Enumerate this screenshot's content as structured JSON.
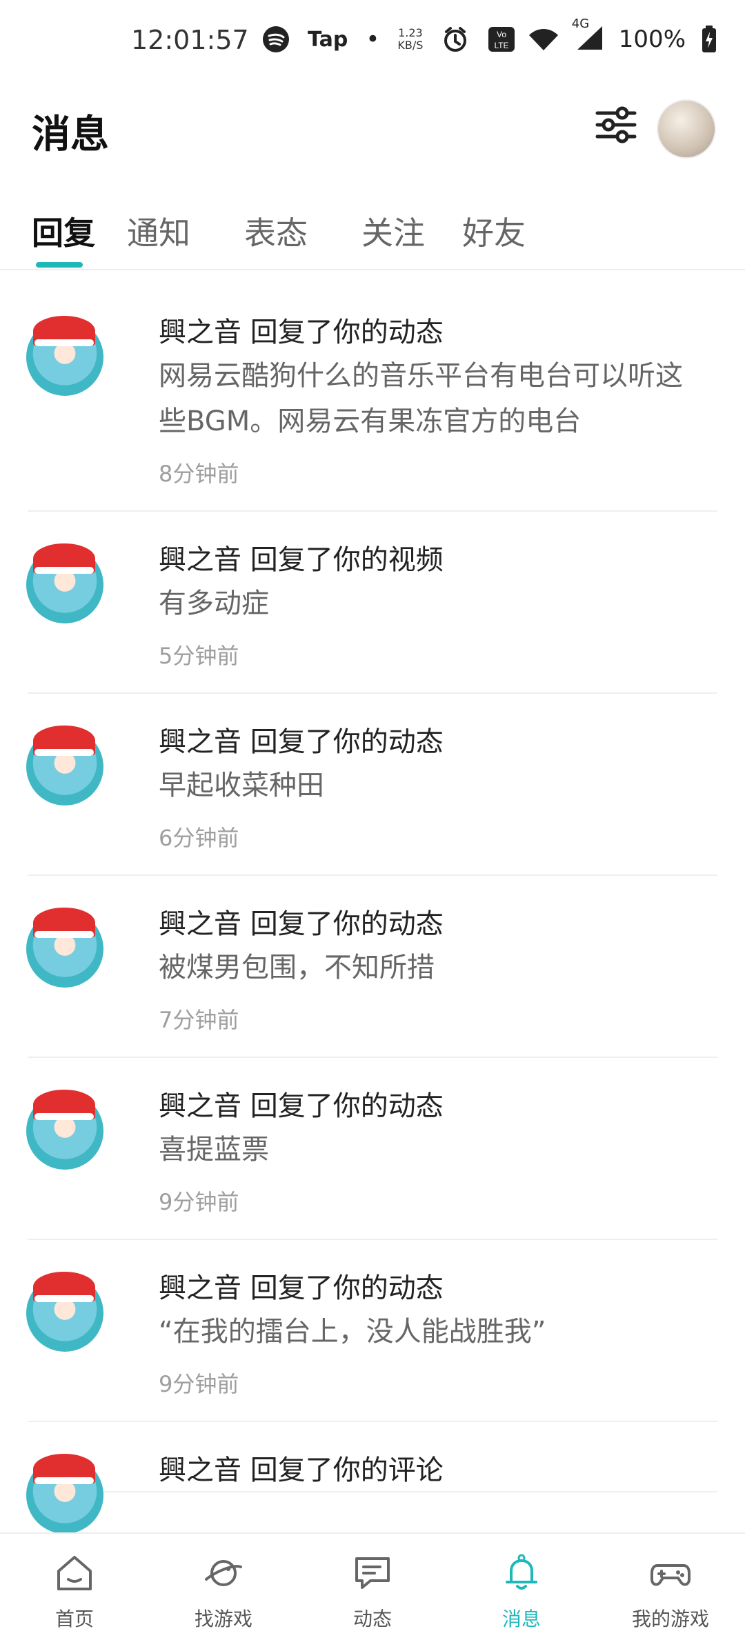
{
  "status_bar": {
    "time": "12:01:57",
    "tap": "Tap",
    "dot": "•",
    "net_speed_top": "1.23",
    "net_speed_bottom": "KB/S",
    "signal_text": "4G",
    "battery": "100%",
    "icons": [
      "spotify-icon",
      "tap-icon",
      "alarm-icon",
      "volte-icon",
      "wifi-icon",
      "cell-signal-icon",
      "battery-charging-icon"
    ]
  },
  "header": {
    "title": "消息",
    "icons": [
      "filter-icon",
      "avatar"
    ]
  },
  "tabs": [
    {
      "label": "回复",
      "active": true
    },
    {
      "label": "通知"
    },
    {
      "label": "表态"
    },
    {
      "label": "关注"
    },
    {
      "label": "好友"
    }
  ],
  "messages": [
    {
      "title": "興之音 回复了你的动态",
      "content": "网易云酷狗什么的音乐平台有电台可以听这些BGM。网易云有果冻官方的电台",
      "time": "8分钟前"
    },
    {
      "title": "興之音 回复了你的视频",
      "content": "有多动症",
      "time": "5分钟前"
    },
    {
      "title": "興之音 回复了你的动态",
      "content": "早起收菜种田",
      "time": "6分钟前"
    },
    {
      "title": "興之音 回复了你的动态",
      "content": "被煤男包围，不知所措",
      "time": "7分钟前"
    },
    {
      "title": "興之音 回复了你的动态",
      "content": "喜提蓝票",
      "time": "9分钟前"
    },
    {
      "title": "興之音 回复了你的动态",
      "content": "“在我的擂台上，没人能战胜我”",
      "time": "9分钟前"
    },
    {
      "title": "興之音 回复了你的评论",
      "content": "",
      "time": ""
    }
  ],
  "bottom_nav": [
    {
      "label": "首页",
      "icon": "home-icon"
    },
    {
      "label": "找游戏",
      "icon": "planet-icon"
    },
    {
      "label": "动态",
      "icon": "chat-icon"
    },
    {
      "label": "消息",
      "icon": "bell-icon",
      "active": true
    },
    {
      "label": "我的游戏",
      "icon": "gamepad-icon"
    }
  ],
  "colors": {
    "accent": "#1fb8b9"
  }
}
